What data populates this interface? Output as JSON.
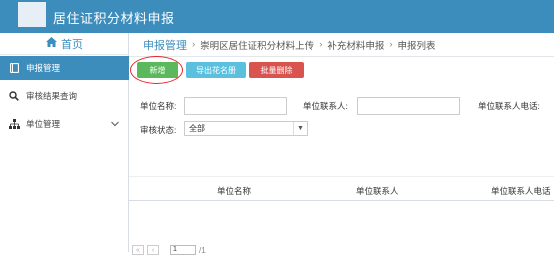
{
  "header": {
    "title": "居住证积分材料申报"
  },
  "sidebar": {
    "home_label": "首页",
    "items": [
      {
        "label": "申报管理",
        "icon": "book-icon",
        "active": true
      },
      {
        "label": "审核结果查询",
        "icon": "search-icon",
        "active": false
      },
      {
        "label": "单位管理",
        "icon": "sitemap-icon",
        "active": false,
        "expandable": true
      }
    ]
  },
  "breadcrumb": {
    "items": [
      "申报管理",
      "崇明区居住证积分材料上传",
      "补充材料申报",
      "申报列表"
    ]
  },
  "toolbar": {
    "add_label": "新增",
    "export_label": "导出花名册",
    "batch_delete_label": "批量删除"
  },
  "filters": {
    "unit_name_label": "单位名称:",
    "unit_contact_label": "单位联系人:",
    "unit_phone_label": "单位联系人电话:",
    "review_status_label": "审核状态:",
    "review_status_value": "全部"
  },
  "table": {
    "columns": [
      "单位名称",
      "单位联系人",
      "单位联系人电话"
    ]
  },
  "pager": {
    "page": "1",
    "total": "/1"
  },
  "colors": {
    "primary": "#3c8dbc",
    "success": "#5cb85c",
    "info": "#5bc0de",
    "danger": "#d9534f",
    "highlight": "#e8262a"
  }
}
